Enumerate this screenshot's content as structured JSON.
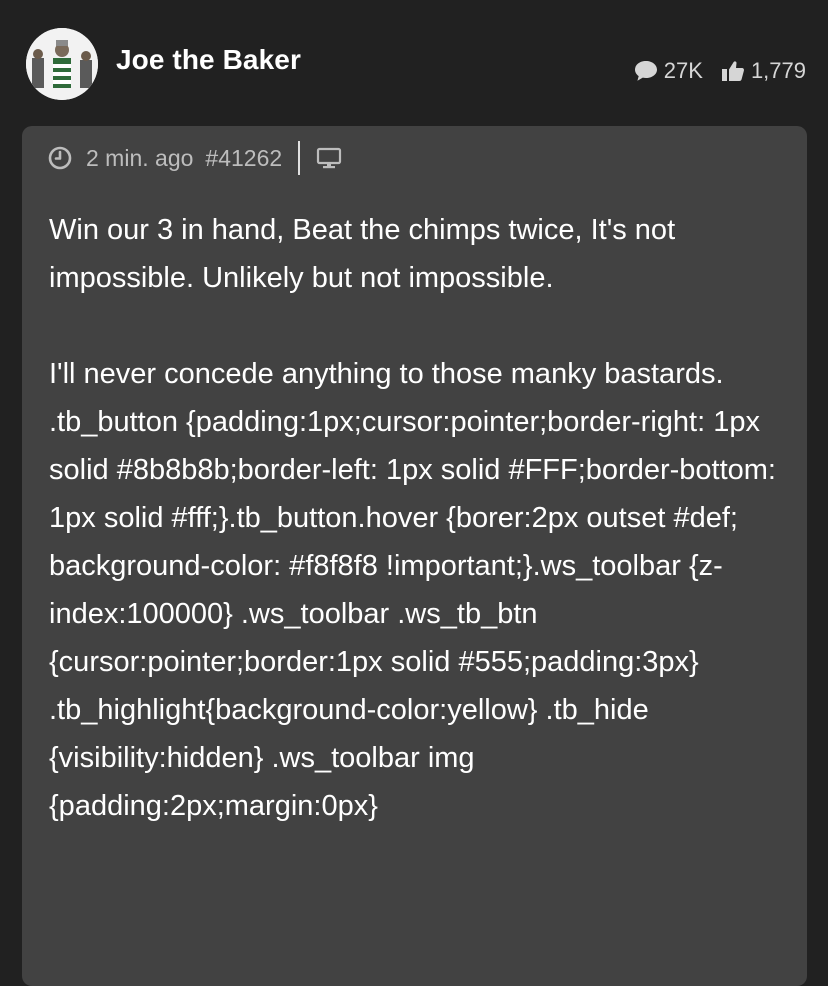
{
  "post": {
    "author": "Joe the Baker",
    "stats": {
      "comments": "27K",
      "likes": "1,779"
    },
    "meta": {
      "time": "2 min. ago",
      "post_id": "#41262"
    },
    "paragraphs": [
      "Win our 3 in hand, Beat the chimps twice, It's not impossible. Unlikely but not impossible.",
      "I'll never concede anything to those manky bastards.",
      ".tb_button {padding:1px;cursor:pointer;border-right: 1px solid #8b8b8b;border-left: 1px solid #FFF;border-bottom: 1px solid #fff;}.tb_button.hover {borer:2px outset #def; background-color: #f8f8f8 !important;}.ws_toolbar {z-index:100000} .ws_toolbar .ws_tb_btn {cursor:pointer;border:1px solid #555;padding:3px} .tb_highlight{background-color:yellow} .tb_hide {visibility:hidden} .ws_toolbar img {padding:2px;margin:0px}"
    ]
  },
  "icons": {
    "comments": "speech-bubble-icon",
    "likes": "thumbs-up-icon",
    "time": "clock-icon",
    "device": "desktop-monitor-icon"
  },
  "colors": {
    "page_background": "#212121",
    "card_background": "#424242",
    "text": "#ffffff",
    "muted_text": "#bdbdbd"
  }
}
